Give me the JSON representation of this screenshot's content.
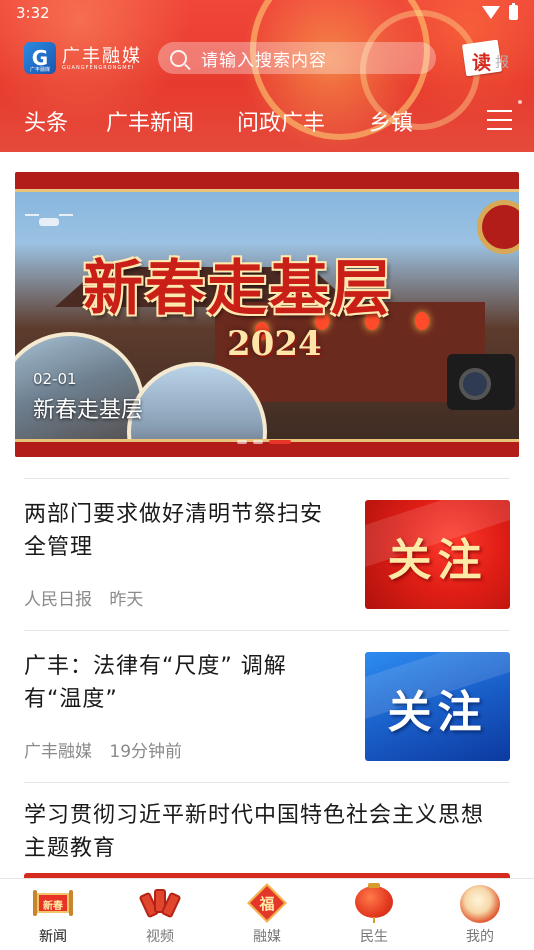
{
  "status_bar": {
    "time": "3:32"
  },
  "header": {
    "brand_name": "广丰融媒",
    "brand_pinyin": "GUANGFENGRONGMEI",
    "logo_text": "G",
    "logo_sub": "广丰融媒",
    "search_placeholder": "请输入搜索内容",
    "read_paper_label": "读",
    "read_paper_label2": "报",
    "tabs": [
      {
        "label": "头条"
      },
      {
        "label": "广丰新闻"
      },
      {
        "label": "问政广丰"
      },
      {
        "label": "乡镇"
      }
    ]
  },
  "banner": {
    "title": "新春走基层",
    "year": "2024",
    "date": "02-01",
    "caption": "新春走基层"
  },
  "news": [
    {
      "title_line1": "两部门要求做好清明节祭扫安",
      "title_line2": "全管理",
      "source": "人民日报",
      "time": "昨天",
      "thumb_text": "关注"
    },
    {
      "title_line1": "广丰：法律有“尺度” 调解",
      "title_line2": "有“温度”",
      "source": "广丰融媒",
      "time": "19分钟前",
      "thumb_text": "关注"
    },
    {
      "title_line1": "学习贯彻习近平新时代中国特色社会主义思想",
      "title_line2": "主题教育"
    }
  ],
  "bottom_nav": {
    "items": [
      {
        "label": "新闻",
        "icon": "scroll-icon",
        "icon_text": "新春",
        "active": true
      },
      {
        "label": "视频",
        "icon": "firecracker-icon"
      },
      {
        "label": "融媒",
        "icon": "fu-diamond-icon",
        "icon_text": "福"
      },
      {
        "label": "民生",
        "icon": "lantern-icon"
      },
      {
        "label": "我的",
        "icon": "drum-icon"
      }
    ]
  },
  "colors": {
    "header_red": "#e73a2e",
    "accent_red": "#d42b1e",
    "thumb_blue": "#1a5fc9"
  }
}
